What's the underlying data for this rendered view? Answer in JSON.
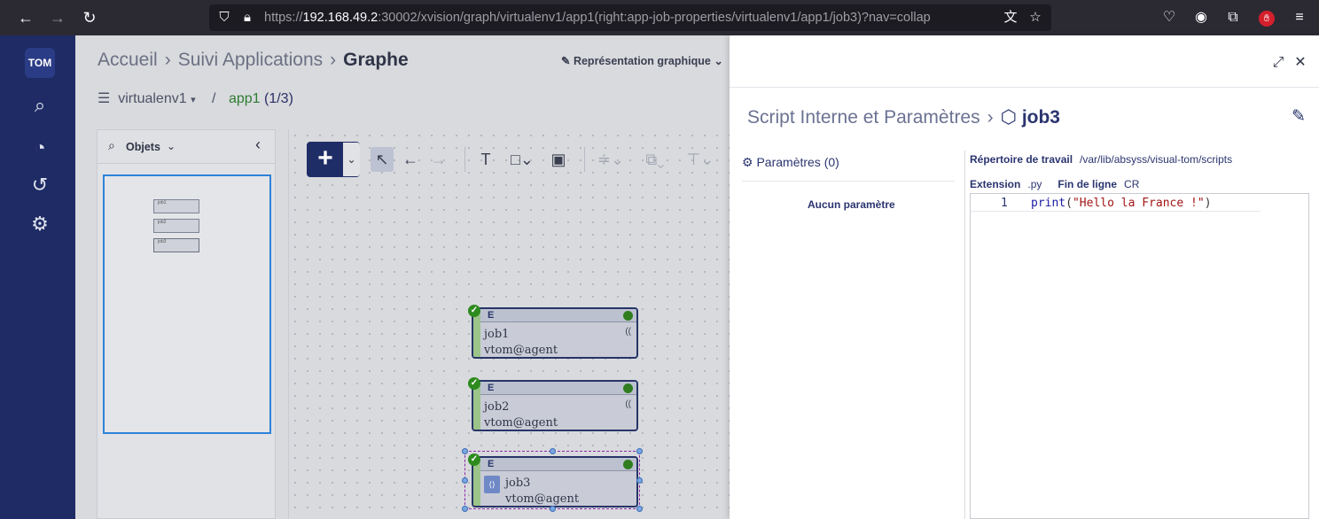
{
  "browser": {
    "url_prefix": "https://",
    "url_host": "192.168.49.2",
    "url_rest": ":30002/xvision/graph/virtualenv1/app1(right:app-job-properties/virtualenv1/app1/job3)?nav=collap"
  },
  "app": {
    "logo": "TOM"
  },
  "main": {
    "breadcrumb": {
      "home": "Accueil",
      "apps": "Suivi Applications",
      "current": "Graphe"
    },
    "repr_label": "Représentation graphique",
    "env": "virtualenv1",
    "app_name": "app1",
    "app_count": "(1/3)",
    "objects_label": "Objets",
    "mini_nodes": [
      "job1",
      "job2",
      "job3"
    ]
  },
  "nodes": [
    {
      "type": "E",
      "name": "job1",
      "agent": "vtom@agent"
    },
    {
      "type": "E",
      "name": "job2",
      "agent": "vtom@agent"
    },
    {
      "type": "E",
      "name": "job3",
      "agent": "vtom@agent"
    }
  ],
  "props": {
    "title": "Script Interne et Paramètres",
    "job_name": "job3",
    "params_label": "Paramètres (0)",
    "no_params": "Aucun paramètre",
    "workdir_label": "Répertoire de travail",
    "workdir_value": "/var/lib/absyss/visual-tom/scripts",
    "ext_label": "Extension",
    "ext_value": ".py",
    "eol_label": "Fin de ligne",
    "eol_value": "CR",
    "code": {
      "line_no": "1",
      "fn": "print",
      "open": "(",
      "str": "\"Hello la France !\"",
      "close": ")"
    }
  },
  "colors": {
    "sidebar": "#1e2b64",
    "accent": "#1f2d66",
    "success": "#2e8b1e",
    "selection": "#8a2aa8"
  }
}
